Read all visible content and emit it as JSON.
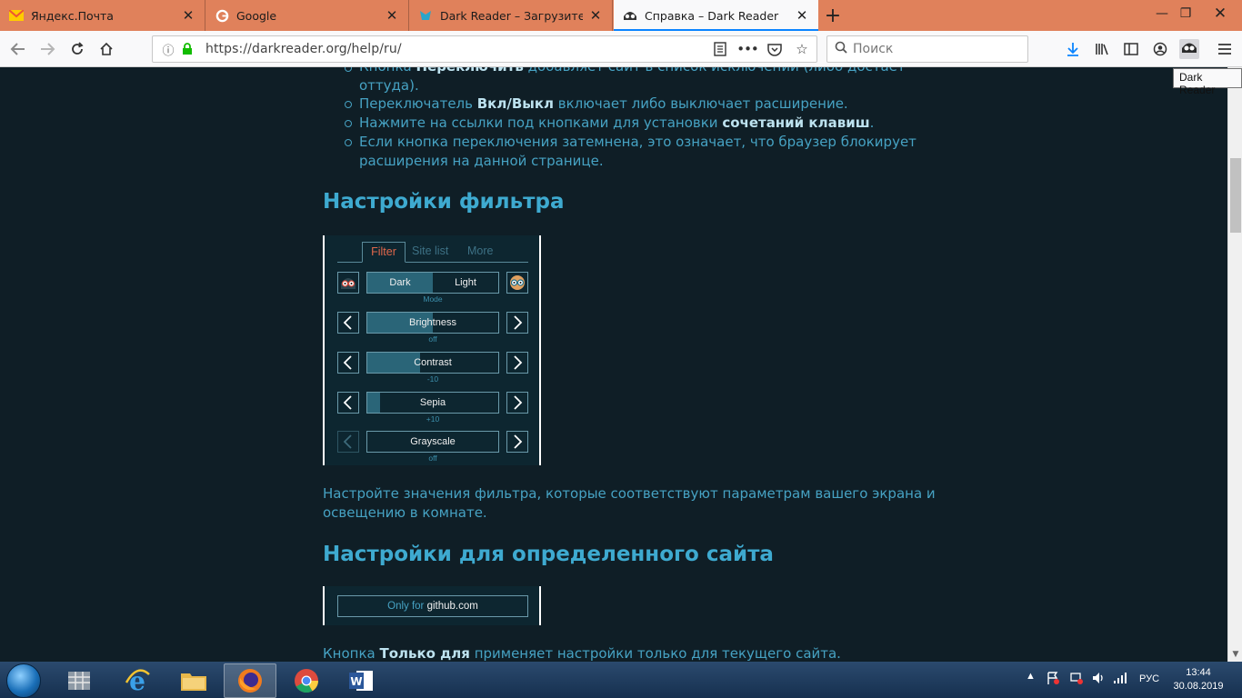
{
  "tabs": [
    {
      "title": "Яндекс.Почта",
      "icon": "mail-icon"
    },
    {
      "title": "Google",
      "icon": "google-icon"
    },
    {
      "title": "Dark Reader – Загрузите это ра",
      "icon": "dark-reader-logo-icon"
    },
    {
      "title": "Справка – Dark Reader",
      "icon": "dark-reader-logo-icon",
      "active": true
    }
  ],
  "navbar": {
    "url": "https://darkreader.org/help/ru/",
    "search_placeholder": "Поиск"
  },
  "tooltip": "Dark Reader",
  "content": {
    "bullets": [
      {
        "pre": "Кнопка ",
        "bold": "Переключить",
        "post": " добавляет сайт в список исключений (либо достает",
        "line2": "оттуда)."
      },
      {
        "pre": "Переключатель ",
        "bold": "Вкл/Выкл",
        "post": " включает либо выключает расширение."
      },
      {
        "pre": "Нажмите на ссылки под кнопками для установки ",
        "bold": "сочетаний клавиш",
        "post": "."
      },
      {
        "pre": "Если кнопка переключения затемнена, это означает, что браузер блокирует",
        "line2": "расширения на данной странице."
      }
    ],
    "heading_filter": "Настройки фильтра",
    "filter_desc_1": "Настройте значения фильтра, которые соответствуют параметрам вашего экрана и",
    "filter_desc_2": "освещению в комнате.",
    "heading_site": "Настройки для определенного сайта",
    "site_desc": {
      "pre": "Кнопка ",
      "bold": "Только для",
      "post": " применяет настройки только для текущего сайта."
    }
  },
  "filter_panel": {
    "tabs": [
      "Filter",
      "Site list",
      "More"
    ],
    "mode": {
      "dark": "Dark",
      "light": "Light",
      "caption": "Mode"
    },
    "sliders": [
      {
        "label": "Brightness",
        "value": "off",
        "fill": 0.5
      },
      {
        "label": "Contrast",
        "value": "-10",
        "fill": 0.4
      },
      {
        "label": "Sepia",
        "value": "+10",
        "fill": 0.1
      },
      {
        "label": "Grayscale",
        "value": "off",
        "fill": 0
      }
    ]
  },
  "site_panel": {
    "prefix": "Only for",
    "site": "github.com"
  },
  "taskbar": {
    "lang": "РУС",
    "time": "13:44",
    "date": "30.08.2019"
  }
}
